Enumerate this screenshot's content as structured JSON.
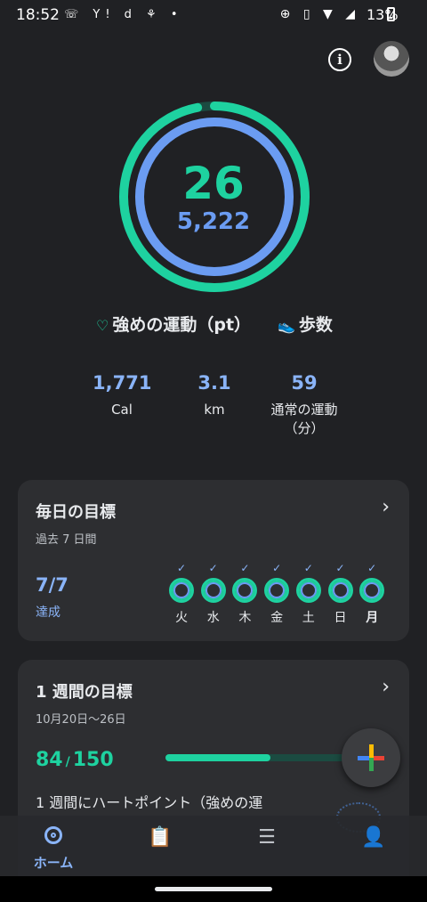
{
  "status_bar": {
    "time": "18:52",
    "notification_icons": "☏ Y! d ⚘ •",
    "system_icons": "⊕ ▯ ▼ ◢",
    "battery_percent": "13%"
  },
  "header": {
    "info_icon": "info-icon",
    "avatar_icon": "profile-avatar"
  },
  "summary": {
    "heart_points": "26",
    "steps": "5,222",
    "heart_points_goal_fraction": 0.97,
    "steps_goal_fraction": 1.0,
    "heart_label": "強めの運動（pt）",
    "steps_label": "歩数"
  },
  "stats": [
    {
      "value": "1,771",
      "label": "Cal"
    },
    {
      "value": "3.1",
      "label": "km"
    },
    {
      "value": "59",
      "label": "通常の運動\n（分）"
    }
  ],
  "daily_goal": {
    "title": "毎日の目標",
    "subtitle": "過去 7 日間",
    "achieved": "7/7",
    "achieved_label": "達成",
    "days": [
      "火",
      "水",
      "木",
      "金",
      "土",
      "日",
      "月"
    ],
    "check": "✓"
  },
  "weekly_goal": {
    "title": "1 週間の目標",
    "date_range": "10月20日～26日",
    "current": "84",
    "separator": "/",
    "target": "150",
    "progress_fraction": 0.56,
    "description": "1 週間にハートポイント（強めの運"
  },
  "chevron": "›",
  "colors": {
    "green": "#1ed2a0",
    "blue": "#6b9cf2",
    "background": "#202124",
    "card": "#2d2e31"
  },
  "bottom_nav": [
    {
      "label": "ホーム",
      "icon": "home-icon"
    },
    {
      "label": "",
      "icon": "journal-icon"
    },
    {
      "label": "",
      "icon": "browse-icon"
    },
    {
      "label": "",
      "icon": "profile-icon"
    }
  ]
}
